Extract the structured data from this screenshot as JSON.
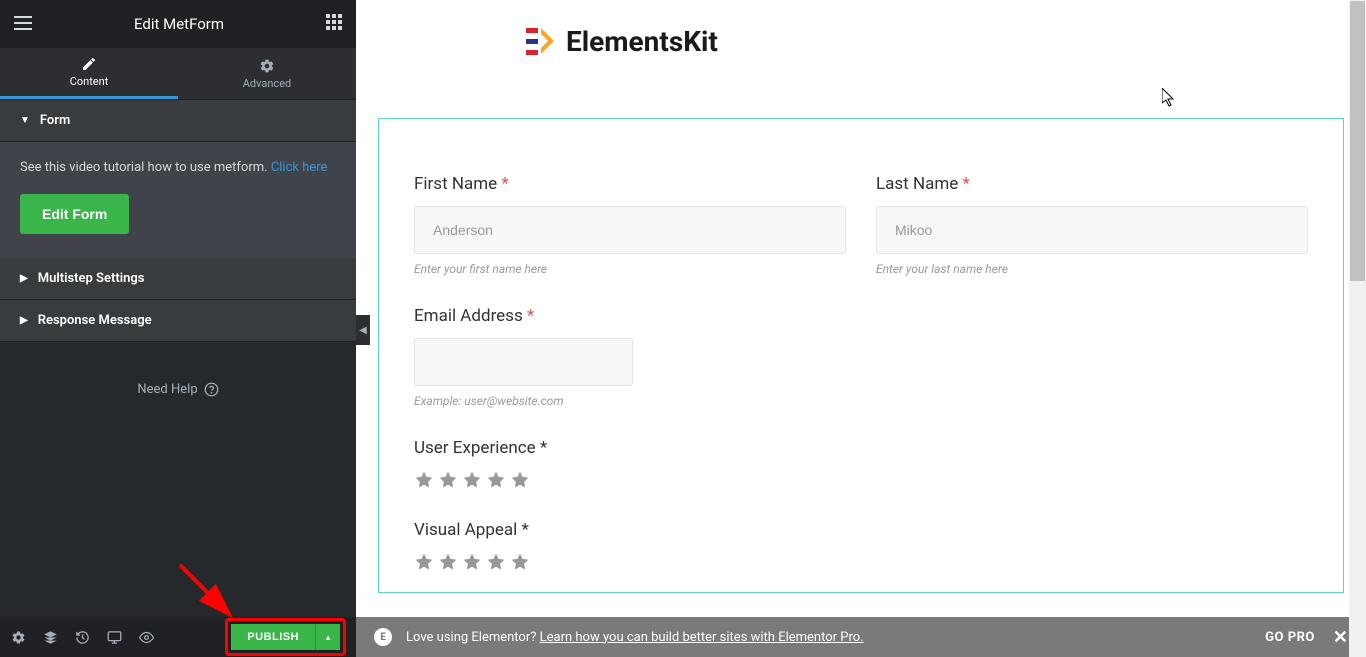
{
  "header": {
    "title": "Edit MetForm"
  },
  "tabs": {
    "content": "Content",
    "advanced": "Advanced"
  },
  "sections": {
    "form": {
      "title": "Form",
      "tutorial_text": "See this video tutorial how to use metform. ",
      "tutorial_link": "Click here",
      "edit_btn": "Edit Form"
    },
    "multistep": {
      "title": "Multistep Settings"
    },
    "response": {
      "title": "Response Message"
    }
  },
  "need_help": "Need Help",
  "footer": {
    "publish": "PUBLISH"
  },
  "logo": "ElementsKit",
  "form": {
    "first_name": {
      "label": "First Name",
      "placeholder": "Anderson",
      "help": "Enter your first name here"
    },
    "last_name": {
      "label": "Last Name",
      "placeholder": "Mikoo",
      "help": "Enter your last name here"
    },
    "email": {
      "label": "Email Address",
      "help": "Example: user@website.com"
    },
    "ux": {
      "label": "User Experience"
    },
    "visual": {
      "label": "Visual Appeal"
    }
  },
  "promo": {
    "text": "Love using Elementor? ",
    "link": "Learn how you can build better sites with Elementor Pro.",
    "go_pro": "GO PRO"
  }
}
